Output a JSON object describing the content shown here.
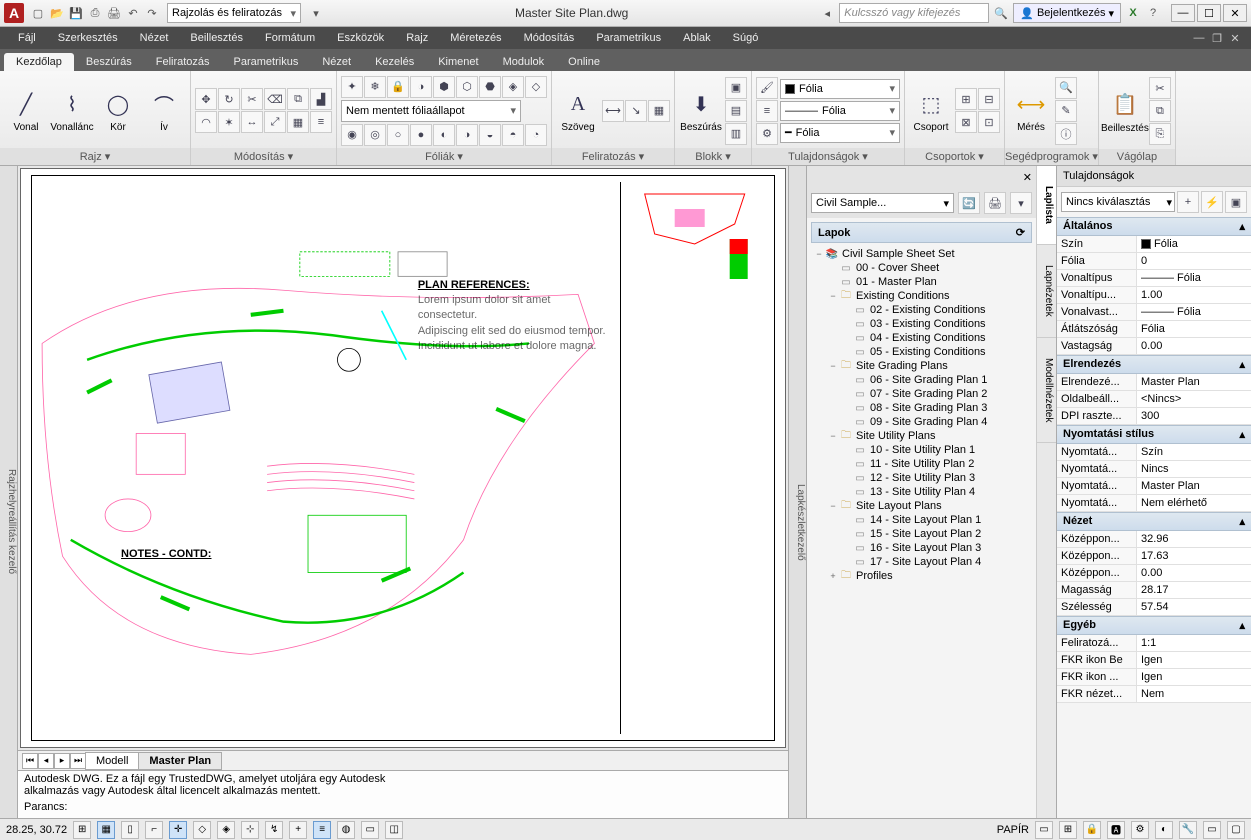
{
  "app": {
    "logo": "A",
    "title": "Master Site Plan.dwg"
  },
  "qat": {
    "workspace": "Rajzolás és feliratozás"
  },
  "search_placeholder": "Kulcsszó vagy kifejezés",
  "login": "Bejelentkezés",
  "menu": [
    "Fájl",
    "Szerkesztés",
    "Nézet",
    "Beillesztés",
    "Formátum",
    "Eszközök",
    "Rajz",
    "Méretezés",
    "Módosítás",
    "Parametrikus",
    "Ablak",
    "Súgó"
  ],
  "tabs": [
    "Kezdőlap",
    "Beszúrás",
    "Feliratozás",
    "Parametrikus",
    "Nézet",
    "Kezelés",
    "Kimenet",
    "Modulok",
    "Online"
  ],
  "ribbon": {
    "draw": {
      "title": "Rajz",
      "btns": {
        "line": "Vonal",
        "pline": "Vonallánc",
        "circle": "Kör",
        "arc": "Ív"
      }
    },
    "modify": {
      "title": "Módosítás"
    },
    "layers": {
      "title": "Fóliák",
      "state": "Nem mentett fóliaállapot"
    },
    "annot": {
      "title": "Feliratozás",
      "text": "Szöveg"
    },
    "block": {
      "title": "Blokk",
      "insert": "Beszúrás"
    },
    "props": {
      "title": "Tulajdonságok",
      "layer": "Fólia",
      "ltype": "Fólia",
      "lweight": "Fólia"
    },
    "groups": {
      "title": "Csoportok",
      "grp": "Csoport"
    },
    "util": {
      "title": "Segédprogramok",
      "measure": "Mérés"
    },
    "clip": {
      "title": "Vágólap",
      "paste": "Beillesztés"
    }
  },
  "left_tool": "Rajzhelyreállítás kezelő",
  "layout_tabs": [
    "Modell",
    "Master Plan"
  ],
  "cmd": {
    "line1": "Autodesk DWG. Ez a fájl egy TrustedDWG, amelyet utoljára egy Autodesk",
    "line2": "alkalmazás vagy Autodesk által licencelt alkalmazás mentett.",
    "prompt": "Parancs:"
  },
  "sheetset": {
    "side_label": "Lapkészletkezelő",
    "combo": "Civil Sample...",
    "header": "Lapok",
    "root": "Civil Sample Sheet Set",
    "cover": "00 - Cover Sheet",
    "master": "01 - Master Plan",
    "sub_existing": "Existing Conditions",
    "ec": [
      "02 - Existing Conditions",
      "03 - Existing Conditions",
      "04 - Existing Conditions",
      "05 - Existing Conditions"
    ],
    "sub_grading": "Site Grading Plans",
    "sg": [
      "06 - Site Grading Plan 1",
      "07 - Site Grading Plan 2",
      "08 - Site Grading Plan 3",
      "09 - Site Grading Plan 4"
    ],
    "sub_utility": "Site Utility Plans",
    "su": [
      "10 - Site Utility Plan 1",
      "11 - Site Utility Plan 2",
      "12 - Site Utility Plan 3",
      "13 - Site Utility Plan 4"
    ],
    "sub_layout": "Site Layout Plans",
    "sl": [
      "14 - Site Layout Plan 1",
      "15 - Site Layout Plan 2",
      "16 - Site Layout Plan 3",
      "17 - Site Layout Plan 4"
    ],
    "sub_profiles": "Profiles",
    "tabs": [
      "Laplista",
      "Lapnézetek",
      "Modellnézetek"
    ]
  },
  "properties": {
    "title": "Tulajdonságok",
    "sel": "Nincs kiválasztás",
    "cat_general": "Általános",
    "general": [
      [
        "Szín",
        "Fólia"
      ],
      [
        "Fólia",
        "0"
      ],
      [
        "Vonaltípus",
        "Fólia"
      ],
      [
        "Vonaltípu...",
        "1.00"
      ],
      [
        "Vonalvast...",
        "Fólia"
      ],
      [
        "Átlátszóság",
        "Fólia"
      ],
      [
        "Vastagság",
        "0.00"
      ]
    ],
    "cat_layout": "Elrendezés",
    "layout": [
      [
        "Elrendezé...",
        "Master Plan"
      ],
      [
        "Oldalbeáll...",
        "<Nincs>"
      ],
      [
        "DPI raszte...",
        "300"
      ]
    ],
    "cat_pstyle": "Nyomtatási stílus",
    "pstyle": [
      [
        "Nyomtatá...",
        "Szín"
      ],
      [
        "Nyomtatá...",
        "Nincs"
      ],
      [
        "Nyomtatá...",
        "Master Plan"
      ],
      [
        "Nyomtatá...",
        "Nem elérhető"
      ]
    ],
    "cat_view": "Nézet",
    "view": [
      [
        "Középpon...",
        "32.96"
      ],
      [
        "Középpon...",
        "17.63"
      ],
      [
        "Középpon...",
        "0.00"
      ],
      [
        "Magasság",
        "28.17"
      ],
      [
        "Szélesség",
        "57.54"
      ]
    ],
    "cat_misc": "Egyéb",
    "misc": [
      [
        "Feliratozá...",
        "1:1"
      ],
      [
        "FKR ikon Be",
        "Igen"
      ],
      [
        "FKR ikon ...",
        "Igen"
      ],
      [
        "FKR nézet...",
        "Nem"
      ]
    ]
  },
  "status": {
    "coords": "28.25, 30.72",
    "paper": "PAPÍR"
  },
  "plan": {
    "refs_title": "PLAN REFERENCES:",
    "notes_title": "NOTES - CONTD:"
  }
}
